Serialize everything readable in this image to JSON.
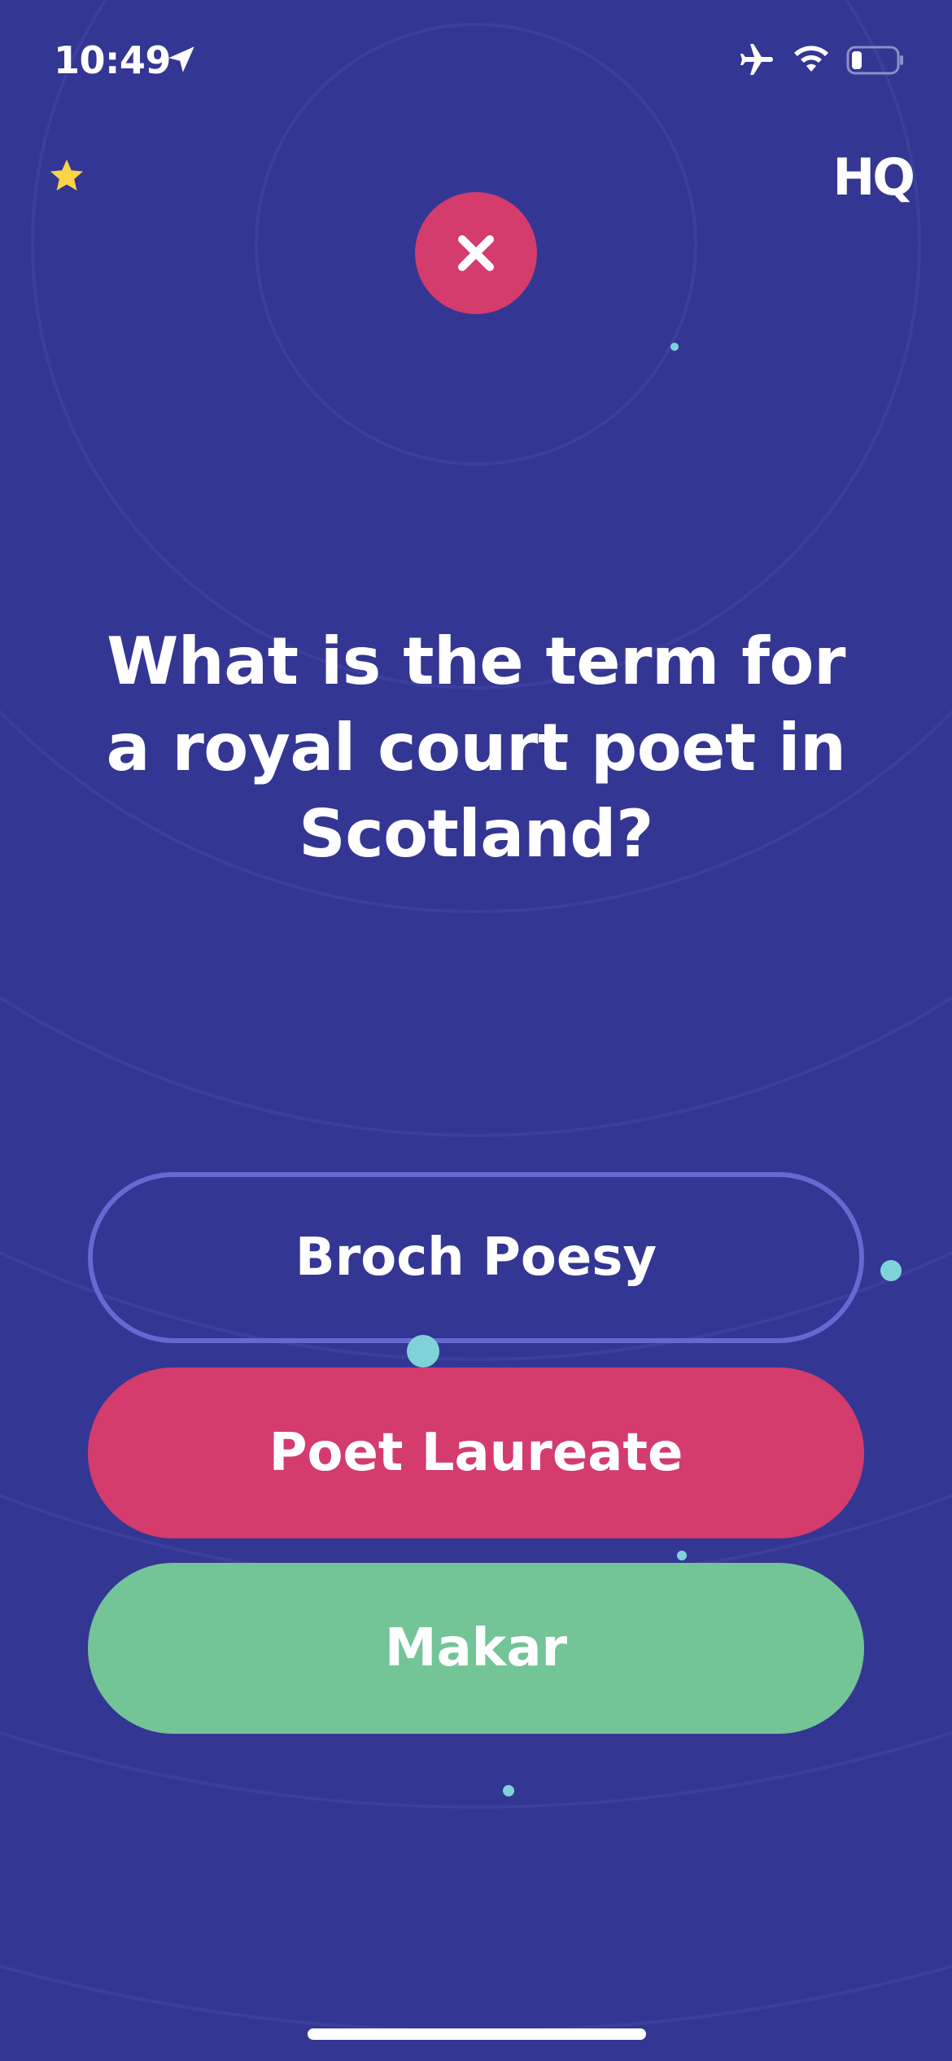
{
  "status_bar": {
    "time": "10:49",
    "icons": [
      "location-icon",
      "airplane-icon",
      "wifi-icon",
      "battery-icon"
    ]
  },
  "header": {
    "star_icon": "star-icon",
    "logo_text": "HQ"
  },
  "result": {
    "icon": "close-icon",
    "state": "incorrect"
  },
  "question": {
    "text": "What is the term for a royal court poet in Scotland?"
  },
  "answers": [
    {
      "label": "Broch Poesy",
      "state": "unselected"
    },
    {
      "label": "Poet Laureate",
      "state": "selected-wrong"
    },
    {
      "label": "Makar",
      "state": "correct"
    }
  ],
  "colors": {
    "background": "#343693",
    "wrong": "#d33c6c",
    "correct": "#73c497",
    "outline": "#6669d2",
    "accent_dot": "#7fd3d8",
    "star": "#f8d448"
  }
}
